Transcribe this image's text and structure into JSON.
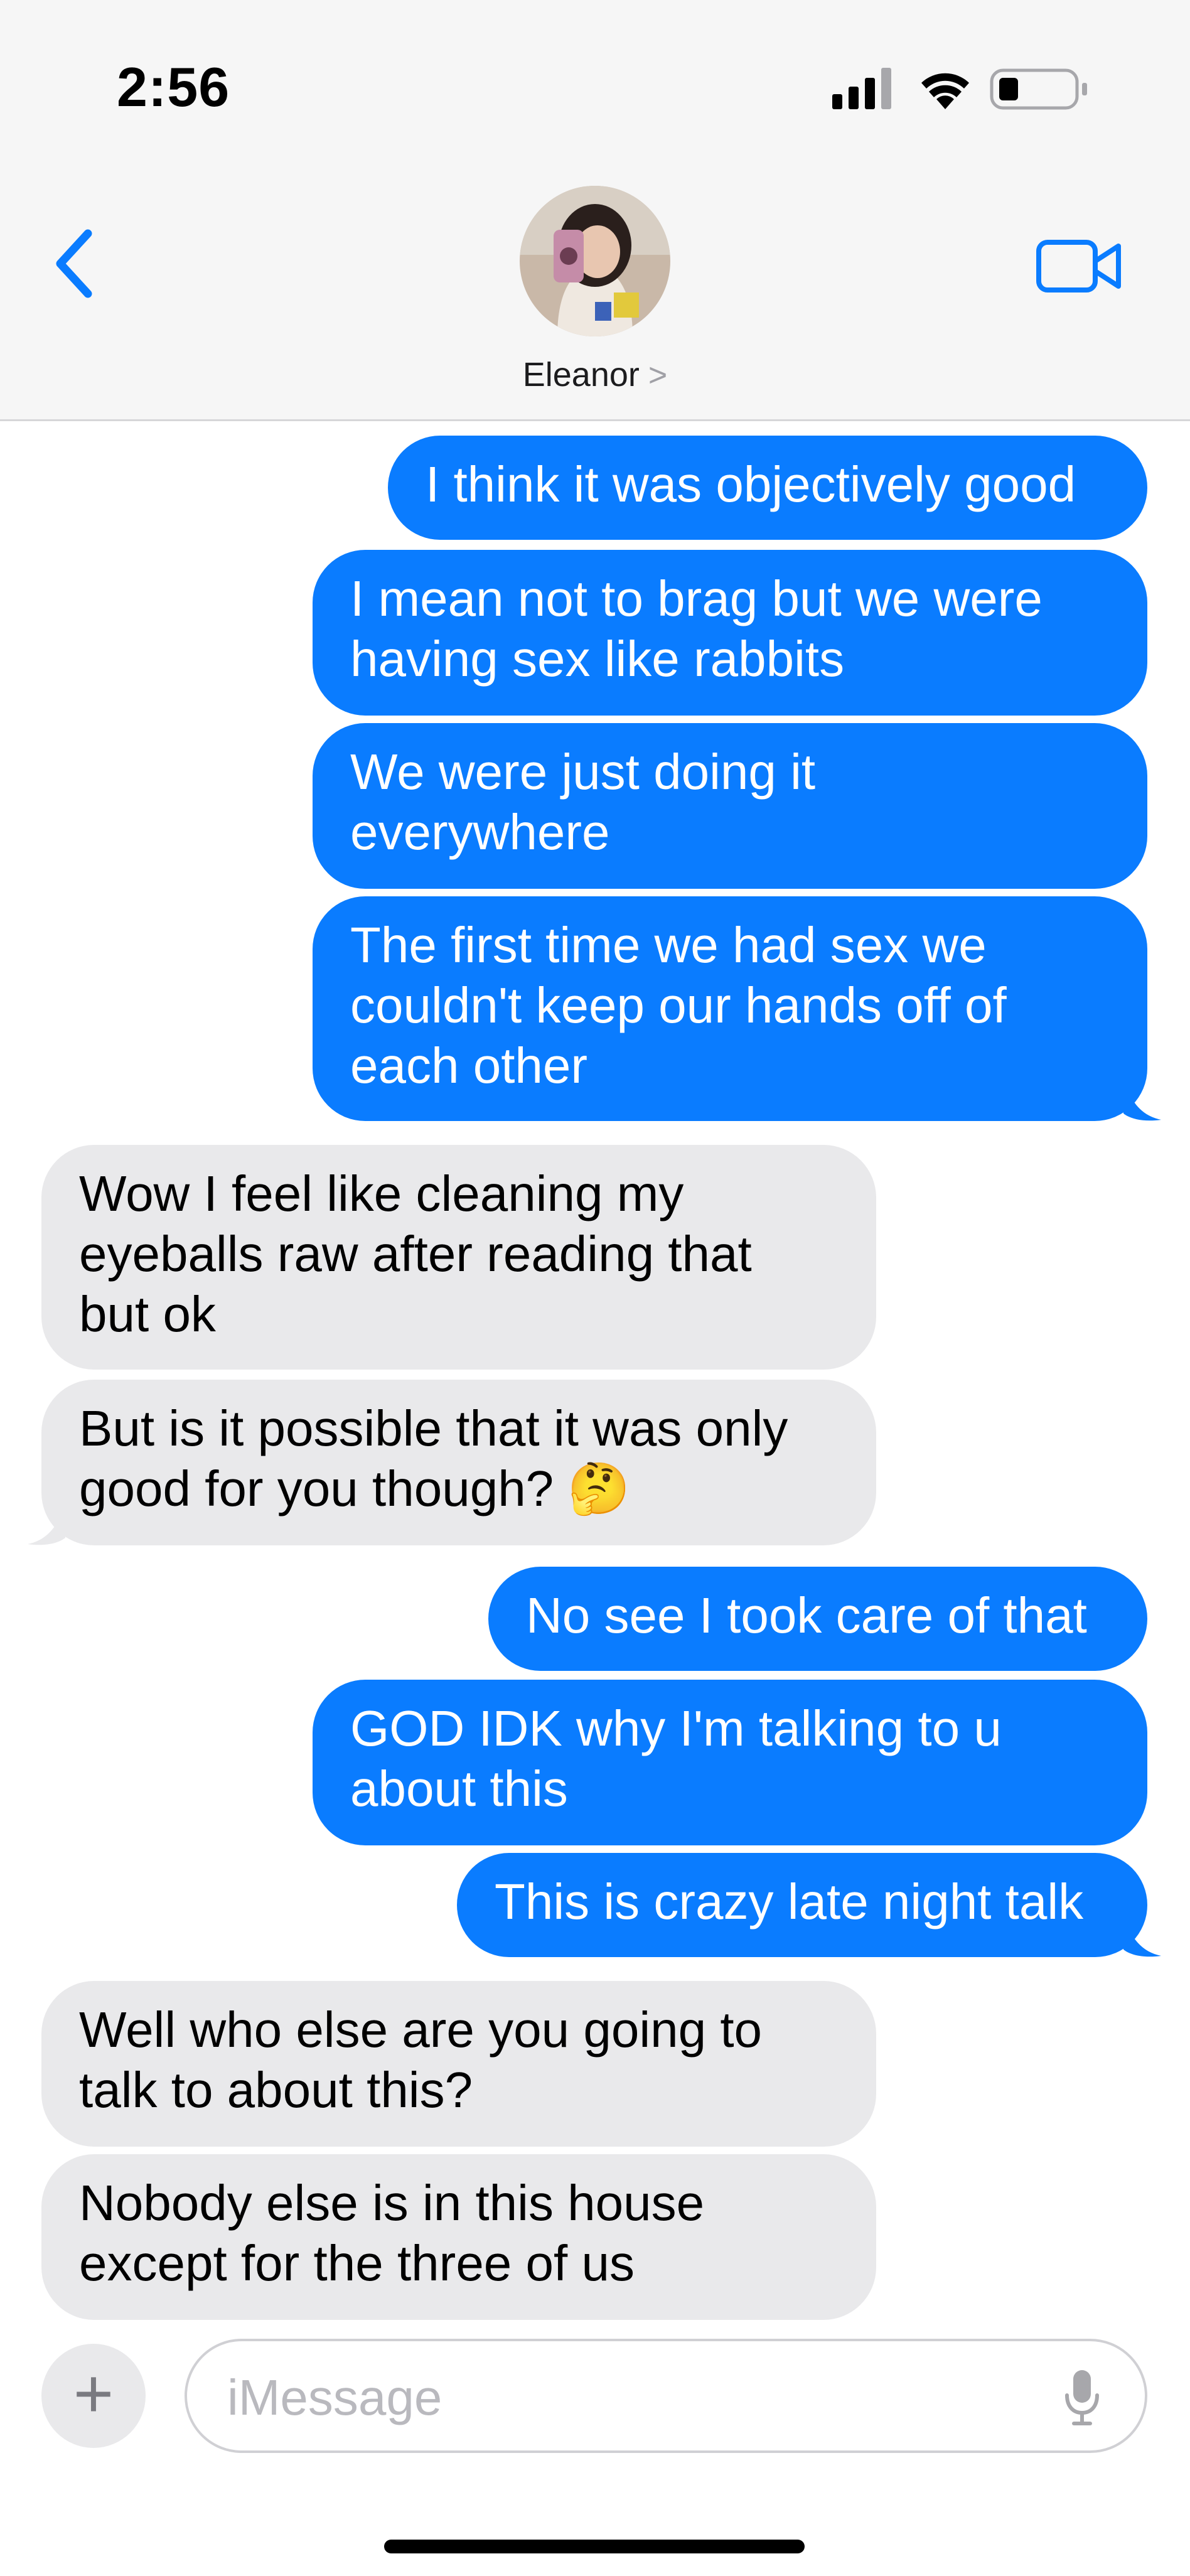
{
  "status_bar": {
    "time": "2:56",
    "signal_icon": "cellular-signal-icon",
    "wifi_icon": "wifi-icon",
    "battery_icon": "battery-icon"
  },
  "header": {
    "back_icon": "chevron-left-icon",
    "contact_name": "Eleanor",
    "contact_chevron": ">",
    "video_icon": "video-camera-icon"
  },
  "messages": [
    {
      "from": "me",
      "text": "I think it was objectively good"
    },
    {
      "from": "me",
      "text": "I mean not to brag but we were\nhaving sex like rabbits"
    },
    {
      "from": "me",
      "text": "We were just doing it\neverywhere"
    },
    {
      "from": "me",
      "text": "The first time we had sex we\ncouldn't keep our hands off of\neach other"
    },
    {
      "from": "them",
      "text": "Wow I feel like cleaning my\neyeballs raw after reading that\nbut ok"
    },
    {
      "from": "them",
      "text": "But is it possible that it was only\ngood for you though? 🤔"
    },
    {
      "from": "me",
      "text": "No see I took care of that"
    },
    {
      "from": "me",
      "text": "GOD IDK why I'm talking to u\nabout this"
    },
    {
      "from": "me",
      "text": "This is crazy late night talk"
    },
    {
      "from": "them",
      "text": "Well who else are you going to\ntalk to about this?"
    },
    {
      "from": "them",
      "text": "Nobody else is in this house\nexcept for the three of us"
    }
  ],
  "composer": {
    "plus_label": "+",
    "placeholder": "iMessage",
    "mic_icon": "microphone-icon"
  },
  "colors": {
    "outgoing_bubble": "#0a7cff",
    "incoming_bubble": "#e9e9eb",
    "accent": "#0a7cff"
  }
}
